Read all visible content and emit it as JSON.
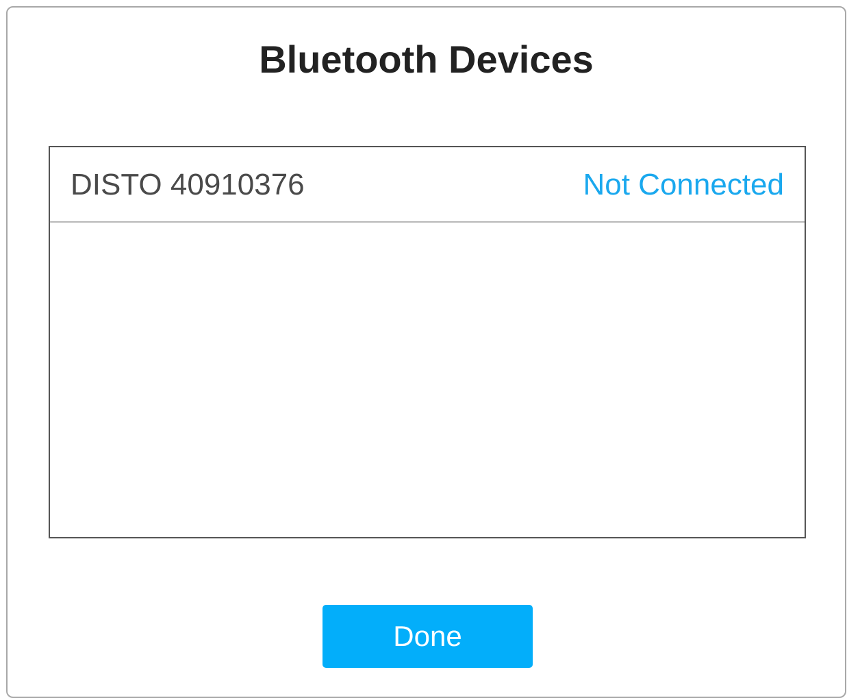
{
  "dialog": {
    "title": "Bluetooth Devices",
    "devices": [
      {
        "name": "DISTO 40910376",
        "status": "Not Connected"
      }
    ],
    "done_label": "Done"
  },
  "colors": {
    "accent": "#03aefa",
    "status_text": "#1aa8ee",
    "title_text": "#222222",
    "device_text": "#4a4a4a"
  }
}
